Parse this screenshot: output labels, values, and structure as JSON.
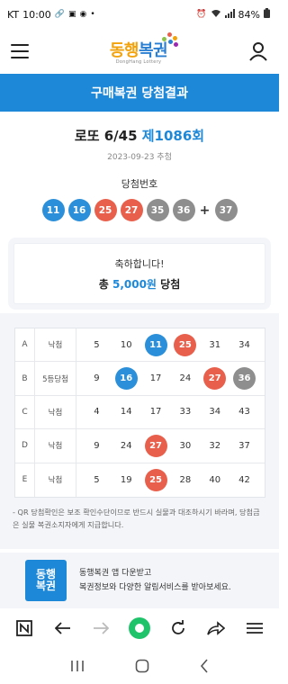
{
  "status": {
    "carrier": "KT",
    "time": "10:00",
    "battery": "84%",
    "left_icons": [
      "link-icon",
      "image-icon",
      "sync-icon",
      "dot-icon"
    ],
    "right_icons": [
      "alarm-icon",
      "wifi-icon",
      "signal-icon",
      "battery-icon"
    ]
  },
  "header": {
    "logo_part1": "동행",
    "logo_part2": "복권",
    "logo_sub": "DongHang Lottery"
  },
  "banner": {
    "title": "구매복권 당첨결과"
  },
  "draw": {
    "game": "로또 6/45",
    "round": "제1086회",
    "date": "2023-09-23 추첨",
    "win_label": "당첨번호",
    "numbers": [
      {
        "n": "11",
        "color": "#2b8fd9"
      },
      {
        "n": "16",
        "color": "#2b8fd9"
      },
      {
        "n": "25",
        "color": "#e8604c"
      },
      {
        "n": "27",
        "color": "#e8604c"
      },
      {
        "n": "35",
        "color": "#8e8e8e"
      },
      {
        "n": "36",
        "color": "#8e8e8e"
      }
    ],
    "plus": "+",
    "bonus": {
      "n": "37",
      "color": "#8e8e8e"
    }
  },
  "result": {
    "congrats": "축하합니다!",
    "prefix": "총",
    "amount": "5,000원",
    "suffix": "당첨"
  },
  "tickets": [
    {
      "slot": "A",
      "result": "낙첨",
      "nums": [
        {
          "n": "5"
        },
        {
          "n": "10"
        },
        {
          "n": "11",
          "color": "#2b8fd9"
        },
        {
          "n": "25",
          "color": "#e8604c"
        },
        {
          "n": "31"
        },
        {
          "n": "34"
        }
      ]
    },
    {
      "slot": "B",
      "result": "5등당첨",
      "nums": [
        {
          "n": "9"
        },
        {
          "n": "16",
          "color": "#2b8fd9"
        },
        {
          "n": "17"
        },
        {
          "n": "24"
        },
        {
          "n": "27",
          "color": "#e8604c"
        },
        {
          "n": "36",
          "color": "#8e8e8e"
        }
      ]
    },
    {
      "slot": "C",
      "result": "낙첨",
      "nums": [
        {
          "n": "4"
        },
        {
          "n": "14"
        },
        {
          "n": "17"
        },
        {
          "n": "33"
        },
        {
          "n": "34"
        },
        {
          "n": "43"
        }
      ]
    },
    {
      "slot": "D",
      "result": "낙첨",
      "nums": [
        {
          "n": "9"
        },
        {
          "n": "24"
        },
        {
          "n": "27",
          "color": "#e8604c"
        },
        {
          "n": "30"
        },
        {
          "n": "32"
        },
        {
          "n": "37"
        }
      ]
    },
    {
      "slot": "E",
      "result": "낙첨",
      "nums": [
        {
          "n": "5"
        },
        {
          "n": "19"
        },
        {
          "n": "25",
          "color": "#e8604c"
        },
        {
          "n": "28"
        },
        {
          "n": "40"
        },
        {
          "n": "42"
        }
      ]
    }
  ],
  "notice": "- QR 당첨확인은 보조 확인수단이므로 반드시 실물과 대조하시기 바라며, 당첨금은 실물 복권소지자에게 지급합니다.",
  "promo": {
    "logo_line1": "동행",
    "logo_line2": "복권",
    "line1": "동행복권 앱 다운받고",
    "line2": "복권정보와 다양한 알림서비스를 받아보세요."
  },
  "browser": {
    "buttons": [
      "n-logo-icon",
      "back-arrow-icon",
      "forward-arrow-icon",
      "home-dot-icon",
      "refresh-icon",
      "share-icon",
      "menu-lines-icon"
    ],
    "accent": "#1fc36a"
  },
  "sysnav": [
    "recents-icon",
    "home-icon",
    "back-icon"
  ]
}
